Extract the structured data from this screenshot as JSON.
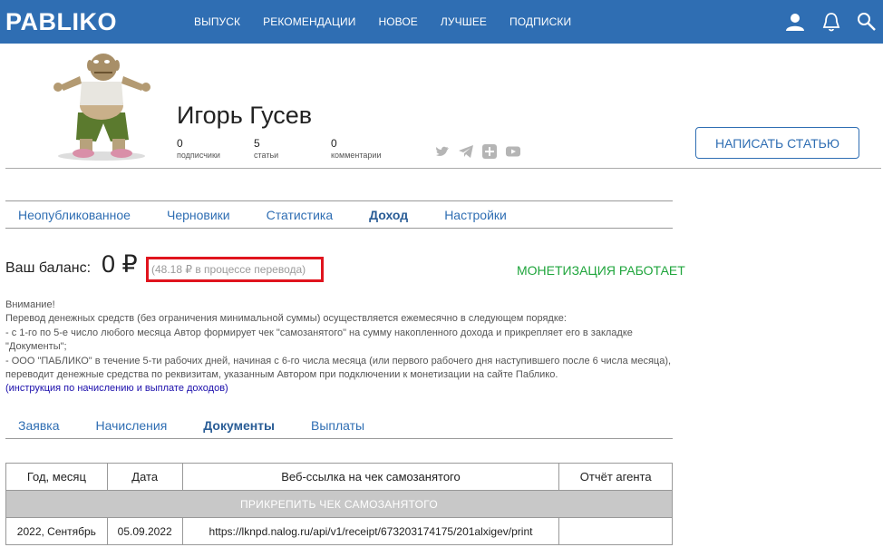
{
  "header": {
    "logo": "PABLIKO",
    "nav": [
      "ВЫПУСК",
      "РЕКОМЕНДАЦИИ",
      "НОВОЕ",
      "ЛУЧШЕЕ",
      "ПОДПИСКИ"
    ]
  },
  "profile": {
    "name": "Игорь Гусев",
    "stats": [
      {
        "value": "0",
        "label": "подписчики"
      },
      {
        "value": "5",
        "label": "статьи"
      },
      {
        "value": "0",
        "label": "комментарии"
      }
    ],
    "write_button": "НАПИСАТЬ СТАТЬЮ"
  },
  "main_tabs": [
    "Неопубликованное",
    "Черновики",
    "Статистика",
    "Доход",
    "Настройки"
  ],
  "balance": {
    "label": "Ваш баланс:",
    "value": "0 ₽",
    "pending": "(48.18 ₽ в процессе перевода)",
    "monetization_status": "МОНЕТИЗАЦИЯ РАБОТАЕТ"
  },
  "notice": {
    "line1": "Внимание!",
    "line2": "Перевод денежных средств (без ограничения минимальной суммы) осуществляется ежемесячно в следующем порядке:",
    "line3": "- с 1-го по 5-е число любого месяца Автор формирует чек \"самозанятого\" на сумму накопленного дохода и прикрепляет его в закладке \"Документы\";",
    "line4": "- ООО \"ПАБЛИКО\" в течение 5-ти рабочих дней, начиная с 6-го числа месяца (или первого рабочего дня наступившего после 6 числа месяца), переводит денежные средства по реквизитам, указанным Автором при подключении к монетизации на сайте Паблико.",
    "link": "(инструкция по начислению и выплате доходов)"
  },
  "sub_tabs": [
    "Заявка",
    "Начисления",
    "Документы",
    "Выплаты"
  ],
  "table": {
    "headers": [
      "Год, месяц",
      "Дата",
      "Веб-ссылка на чек самозанятого",
      "Отчёт агента"
    ],
    "attach_button": "ПРИКРЕПИТЬ ЧЕК САМОЗАНЯТОГО",
    "rows": [
      {
        "period": "2022, Сентябрь",
        "date": "05.09.2022",
        "link": "https://lknpd.nalog.ru/api/v1/receipt/673203174175/201alxigev/print",
        "report": ""
      }
    ]
  },
  "colors": {
    "brand": "#2f6eb3",
    "status_ok": "#1fa53c",
    "highlight": "#e0141e"
  }
}
